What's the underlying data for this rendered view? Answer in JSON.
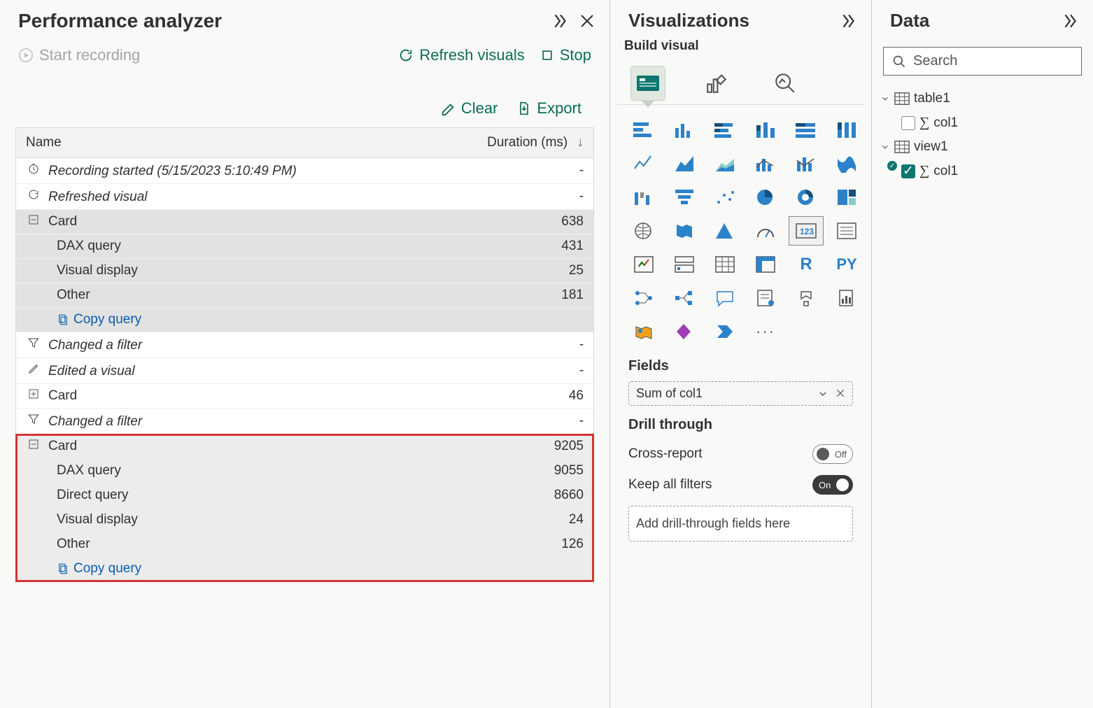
{
  "perf": {
    "title": "Performance analyzer",
    "start_recording": "Start recording",
    "refresh_visuals": "Refresh visuals",
    "stop": "Stop",
    "clear": "Clear",
    "export": "Export",
    "col_name": "Name",
    "col_duration": "Duration (ms)",
    "rows": {
      "recording_started": "Recording started (5/15/2023 5:10:49 PM)",
      "refreshed_visual": "Refreshed visual",
      "card1": {
        "label": "Card",
        "duration": "638"
      },
      "card1_dax": {
        "label": "DAX query",
        "duration": "431"
      },
      "card1_vis": {
        "label": "Visual display",
        "duration": "25"
      },
      "card1_other": {
        "label": "Other",
        "duration": "181"
      },
      "copy_query": "Copy query",
      "changed_filter1": "Changed a filter",
      "edited_visual": "Edited a visual",
      "card2": {
        "label": "Card",
        "duration": "46"
      },
      "changed_filter2": "Changed a filter",
      "card3": {
        "label": "Card",
        "duration": "9205"
      },
      "card3_dax": {
        "label": "DAX query",
        "duration": "9055"
      },
      "card3_direct": {
        "label": "Direct query",
        "duration": "8660"
      },
      "card3_vis": {
        "label": "Visual display",
        "duration": "24"
      },
      "card3_other": {
        "label": "Other",
        "duration": "126"
      }
    }
  },
  "viz": {
    "title": "Visualizations",
    "build_visual": "Build visual",
    "fields_label": "Fields",
    "field_pill": "Sum of col1",
    "drill_through": "Drill through",
    "cross_report": "Cross-report",
    "cross_report_state": "Off",
    "keep_all_filters": "Keep all filters",
    "keep_all_filters_state": "On",
    "drop_zone": "Add drill-through fields here",
    "letter_R": "R",
    "letter_PY": "PY"
  },
  "data": {
    "title": "Data",
    "search_placeholder": "Search",
    "table1": "table1",
    "table1_col1": "col1",
    "view1": "view1",
    "view1_col1": "col1"
  }
}
